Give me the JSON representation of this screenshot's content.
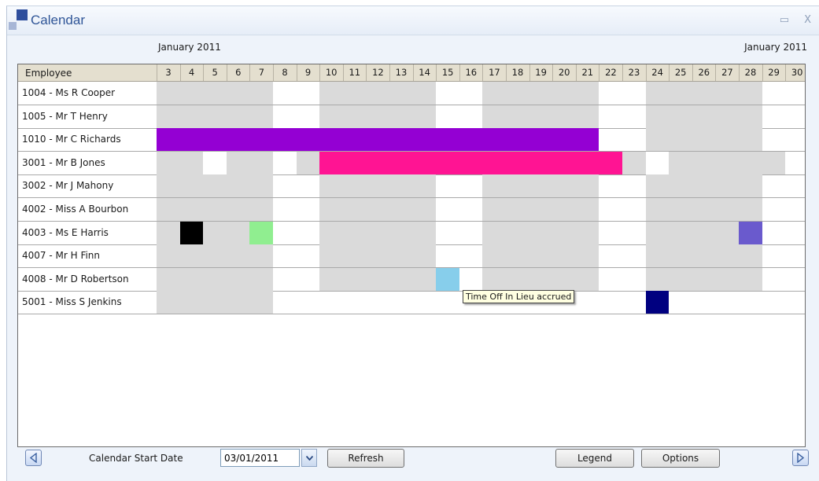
{
  "window": {
    "title": "Calendar",
    "minimize_glyph": "▭",
    "close_glyph": "X"
  },
  "months": {
    "left": "January 2011",
    "right": "January 2011"
  },
  "grid": {
    "employee_header": "Employee",
    "days": [
      "3",
      "4",
      "5",
      "6",
      "7",
      "8",
      "9",
      "10",
      "11",
      "12",
      "13",
      "14",
      "15",
      "16",
      "17",
      "18",
      "19",
      "20",
      "21",
      "22",
      "23",
      "24",
      "25",
      "26",
      "27",
      "28",
      "29",
      "30"
    ],
    "rows": [
      {
        "name": "1004 - Ms R Cooper"
      },
      {
        "name": "1005 - Mr T Henry"
      },
      {
        "name": "1010 - Mr C Richards"
      },
      {
        "name": "3001 - Mr B Jones"
      },
      {
        "name": "3002 - Mr J Mahony"
      },
      {
        "name": "4002 - Miss A Bourbon"
      },
      {
        "name": "4003 - Ms E Harris"
      },
      {
        "name": "4007 - Mr H Finn"
      },
      {
        "name": "4008 - Mr D Robertson"
      },
      {
        "name": "5001 - Miss S Jenkins"
      }
    ],
    "colors": {
      "shaded": "#dadada",
      "purple": "#9400d3",
      "pink": "#ff1493",
      "black": "#000000",
      "light_green": "#90ee90",
      "slate_blue": "#6a5acd",
      "sky_blue": "#87ceeb",
      "navy": "#000080"
    }
  },
  "tooltip": {
    "text": "Time Off In Lieu accrued"
  },
  "footer": {
    "start_date_label": "Calendar Start Date",
    "start_date_value": "03/01/2011",
    "refresh_label": "Refresh",
    "legend_label": "Legend",
    "options_label": "Options"
  }
}
